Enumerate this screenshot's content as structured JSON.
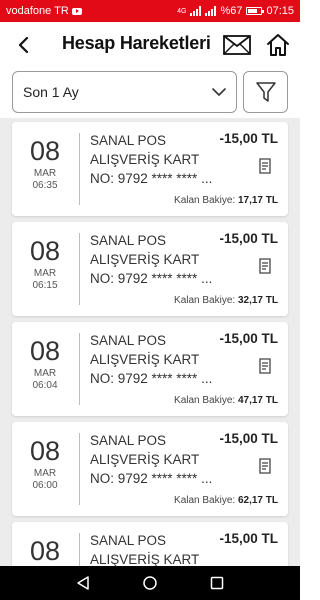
{
  "status": {
    "carrier": "vodafone TR",
    "battery": "%67",
    "time": "07:15",
    "network": "4G"
  },
  "header": {
    "title": "Hesap Hareketleri"
  },
  "filter": {
    "period": "Son 1 Ay"
  },
  "transactions": [
    {
      "day": "08",
      "month": "MAR",
      "time": "06:35",
      "description": "SANAL POS\nALIŞVERİŞ KART\nNO: 9792 **** **** ...",
      "amount": "-15,00 TL",
      "balance_label": "Kalan Bakiye:",
      "balance": "17,17 TL"
    },
    {
      "day": "08",
      "month": "MAR",
      "time": "06:15",
      "description": "SANAL POS\nALIŞVERİŞ KART\nNO: 9792 **** **** ...",
      "amount": "-15,00 TL",
      "balance_label": "Kalan Bakiye:",
      "balance": "32,17 TL"
    },
    {
      "day": "08",
      "month": "MAR",
      "time": "06:04",
      "description": "SANAL POS\nALIŞVERİŞ KART\nNO: 9792 **** **** ...",
      "amount": "-15,00 TL",
      "balance_label": "Kalan Bakiye:",
      "balance": "47,17 TL"
    },
    {
      "day": "08",
      "month": "MAR",
      "time": "06:00",
      "description": "SANAL POS\nALIŞVERİŞ KART\nNO: 9792 **** **** ...",
      "amount": "-15,00 TL",
      "balance_label": "Kalan Bakiye:",
      "balance": "62,17 TL"
    },
    {
      "day": "08",
      "month": "",
      "time": "",
      "description": "SANAL POS\nALIŞVERİŞ KART",
      "amount": "-15,00 TL",
      "balance_label": "",
      "balance": ""
    }
  ],
  "colors": {
    "brand_red": "#e30a17",
    "background": "#ececec"
  },
  "icons": {
    "back": "chevron-left-icon",
    "mail": "envelope-icon",
    "home": "home-icon",
    "filter": "funnel-icon",
    "dropdown": "chevron-down-icon",
    "receipt": "receipt-icon",
    "nav_back": "triangle-back-icon",
    "nav_home": "circle-home-icon",
    "nav_recent": "square-recent-icon"
  }
}
